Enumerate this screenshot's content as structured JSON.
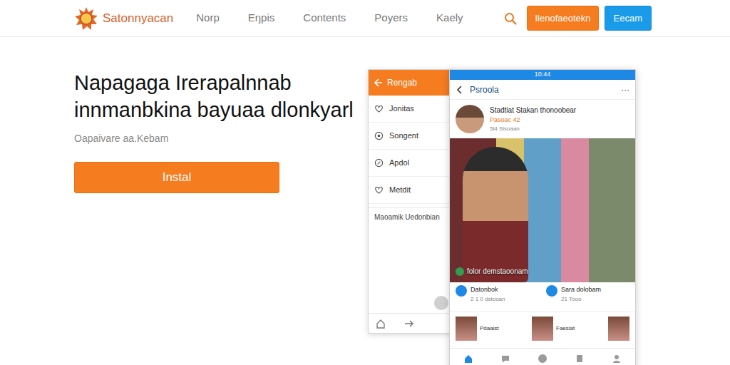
{
  "brand": {
    "name": "Satonnyacan"
  },
  "nav": [
    {
      "label": "Norp"
    },
    {
      "label": "Eŋpis"
    },
    {
      "label": "Contents"
    },
    {
      "label": "Poyers"
    },
    {
      "label": "Kaely"
    }
  ],
  "header_buttons": [
    "Ilenofaeotekn",
    "Eecam"
  ],
  "hero": {
    "title": [
      "Napagaga Irerapalnnab",
      "innmanbkina bayuaa dlonkyarl"
    ],
    "subtitle": "Oapaivare aa.Kebam",
    "button": "Instal"
  },
  "phone_left": {
    "title": "Rengab",
    "items": [
      {
        "label": "Jonitas"
      },
      {
        "label": "Songent"
      },
      {
        "label": "Apdol"
      },
      {
        "label": "Metdit"
      }
    ],
    "note": "Maoamik Uedonbian"
  },
  "phone_right": {
    "status_time": "10:44",
    "title": "Psroola",
    "more": "···",
    "profile": {
      "name": "Stadtiat Stakan thonoobear",
      "subtitle": "Pasoac 42",
      "meta": "5l4 Sisoaan"
    },
    "photo_caption": "folor demstaoonam",
    "posts": [
      {
        "name": "Datonbok",
        "meta": "2 1 0 dstooan"
      },
      {
        "name": "Sara dolobam",
        "meta": "21 Tooo"
      }
    ],
    "thumbs": [
      {
        "label": "Pdaaist"
      },
      {
        "label": "Faesiat"
      }
    ],
    "tabs": [
      {
        "selected": true
      },
      {
        "selected": false
      },
      {
        "selected": false
      },
      {
        "selected": false
      },
      {
        "selected": false
      }
    ]
  }
}
